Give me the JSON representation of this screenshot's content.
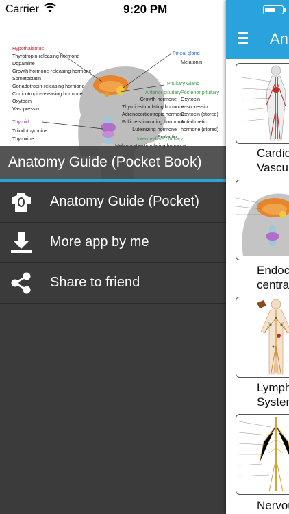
{
  "status_bar": {
    "carrier": "Carrier",
    "time": "9:20 PM"
  },
  "header_diagram": {
    "hypothalamus": {
      "title": "Hypothalamus",
      "hormones": [
        "Thyrotropin-releasing hormone",
        "Dopamine",
        "Growth hormone-releasing hormone",
        "Somatostatin",
        "Gonadotropin-releasing hormone",
        "Corticotropin-releasing hormone",
        "Oxytocin",
        "Vasopressin"
      ]
    },
    "thyroid": {
      "title": "Thyroid",
      "hormones": [
        "Triiodothyronine",
        "Thyroxine"
      ]
    },
    "pineal": {
      "title": "Pineal gland",
      "hormones": [
        "Melatonin"
      ]
    },
    "pituitary": {
      "title": "Pituitary Gland",
      "anterior_title": "Anterior pituitary",
      "anterior": [
        "Growth hormone",
        "Thyroid-stimulating hormone",
        "Adrenocorticotropic hormone",
        "Follicle-stimulating hormone",
        "Luteinizing hormone",
        "Prolactin"
      ],
      "posterior_title": "Posterior pituitary",
      "posterior": [
        "Oxytocin",
        "Vasopressin",
        "Oxytocin (stored)",
        "Anti-diuretic",
        "hormone (stored)"
      ],
      "intermediate_title": "Intermediate pituitary",
      "intermediate": [
        "Melanocyte-stimulating hormone"
      ]
    }
  },
  "drawer": {
    "title": "Anatomy Guide (Pocket Book)",
    "menu": [
      {
        "label": "Anatomy Guide (Pocket)",
        "icon": "torso-icon"
      },
      {
        "label": "More app by me",
        "icon": "download-icon"
      },
      {
        "label": "Share to friend",
        "icon": "share-icon"
      }
    ]
  },
  "main": {
    "title": "An",
    "battery_level": 0.6,
    "cards": [
      {
        "label_line1": "Cardio",
        "label_line2": "Vascula"
      },
      {
        "label_line1": "Endocrin",
        "label_line2": "central"
      },
      {
        "label_line1": "Lympha",
        "label_line2": "System"
      },
      {
        "label_line1": "Nervou",
        "label_line2": ""
      }
    ]
  },
  "colors": {
    "accent": "#2aa3dc",
    "drawer_bg": "#3b3b3b",
    "hypothalamus": "#c0272d",
    "pineal": "#2b6fb6",
    "pituitary": "#3b9a47",
    "thyroid": "#8e44ad"
  }
}
